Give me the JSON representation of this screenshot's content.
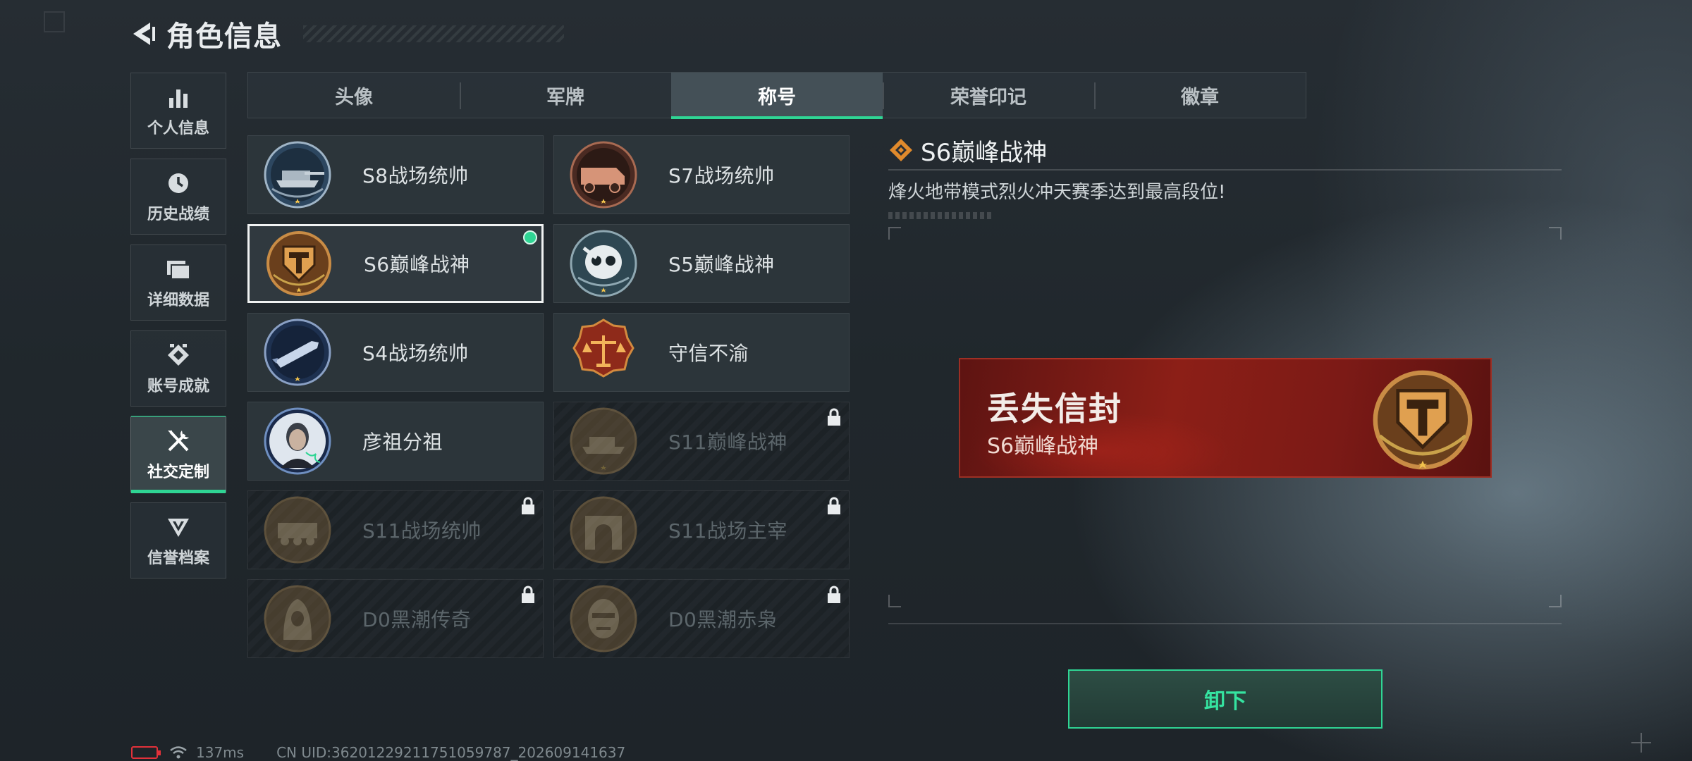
{
  "header": {
    "title": "角色信息"
  },
  "sidebar": {
    "items": [
      {
        "label": "个人信息",
        "icon": "bar-chart-icon",
        "active": false
      },
      {
        "label": "历史战绩",
        "icon": "clock-icon",
        "active": false
      },
      {
        "label": "详细数据",
        "icon": "folder-icon",
        "active": false
      },
      {
        "label": "账号成就",
        "icon": "achievement-icon",
        "active": false
      },
      {
        "label": "社交定制",
        "icon": "tools-icon",
        "active": true
      },
      {
        "label": "信誉档案",
        "icon": "emblem-icon",
        "active": false
      }
    ]
  },
  "tabs": [
    {
      "label": "头像",
      "active": false
    },
    {
      "label": "军牌",
      "active": false
    },
    {
      "label": "称号",
      "active": true
    },
    {
      "label": "荣誉印记",
      "active": false
    },
    {
      "label": "徽章",
      "active": false
    }
  ],
  "titles": [
    {
      "name": "S8战场统帅",
      "icon": "tank-medal-icon",
      "locked": false,
      "selected": false,
      "equipped": false
    },
    {
      "name": "S7战场统帅",
      "icon": "armored-car-medal-icon",
      "locked": false,
      "selected": false,
      "equipped": false
    },
    {
      "name": "S6巅峰战神",
      "icon": "t-shield-medal-icon",
      "locked": false,
      "selected": true,
      "equipped": true
    },
    {
      "name": "S5巅峰战神",
      "icon": "skull-medal-icon",
      "locked": false,
      "selected": false,
      "equipped": false
    },
    {
      "name": "S4战场统帅",
      "icon": "missile-medal-icon",
      "locked": false,
      "selected": false,
      "equipped": false
    },
    {
      "name": "守信不渝",
      "icon": "scales-medal-icon",
      "locked": false,
      "selected": false,
      "equipped": false
    },
    {
      "name": "彦祖分祖",
      "icon": "portrait-medal-icon",
      "locked": false,
      "selected": false,
      "equipped": false
    },
    {
      "name": "S11巅峰战神",
      "icon": "tank-medal-icon",
      "locked": true,
      "selected": false,
      "equipped": false
    },
    {
      "name": "S11战场统帅",
      "icon": "vehicle-medal-icon",
      "locked": true,
      "selected": false,
      "equipped": false
    },
    {
      "name": "S11战场主宰",
      "icon": "arch-medal-icon",
      "locked": true,
      "selected": false,
      "equipped": false
    },
    {
      "name": "D0黑潮传奇",
      "icon": "hooded-figure-medal-icon",
      "locked": true,
      "selected": false,
      "equipped": false
    },
    {
      "name": "D0黑潮赤枭",
      "icon": "mask-medal-icon",
      "locked": true,
      "selected": false,
      "equipped": false
    }
  ],
  "detail": {
    "title": "S6巅峰战神",
    "description": "烽火地带模式烈火冲天赛季达到最高段位!"
  },
  "preview": {
    "main": "丢失信封",
    "sub": "S6巅峰战神"
  },
  "actions": {
    "unequip": "卸下"
  },
  "status": {
    "ping": "137ms",
    "uid": "CN UID:3620122921175105978​7_202609141637"
  },
  "colors": {
    "accent": "#2fd594",
    "plate": "#8c1f17",
    "battery": "#e2313a"
  }
}
